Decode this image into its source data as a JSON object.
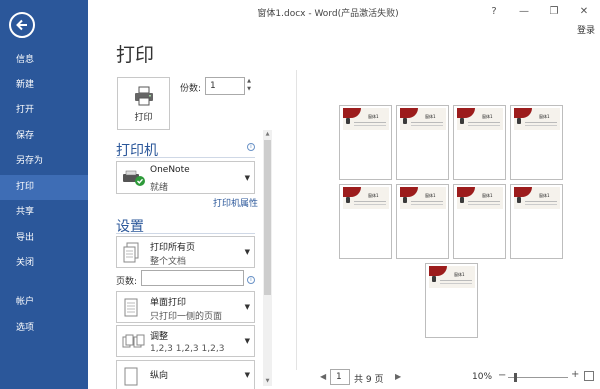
{
  "titlebar": {
    "title": "窗体1.docx - Word(产品激活失败)",
    "help": "?",
    "minimize": "—",
    "restore": "❐",
    "close": "✕",
    "login": "登录"
  },
  "nav": {
    "items": [
      {
        "label": "信息"
      },
      {
        "label": "新建"
      },
      {
        "label": "打开"
      },
      {
        "label": "保存"
      },
      {
        "label": "另存为"
      },
      {
        "label": "打印"
      },
      {
        "label": "共享"
      },
      {
        "label": "导出"
      },
      {
        "label": "关闭"
      },
      {
        "label": "帐户"
      },
      {
        "label": "选项"
      }
    ]
  },
  "print": {
    "title": "打印",
    "button_label": "打印",
    "copies_label": "份数:",
    "copies_value": "1",
    "printer_section": "打印机",
    "printer_name": "OneNote",
    "printer_status": "就绪",
    "printer_properties": "打印机属性",
    "settings_section": "设置",
    "pages_label": "页数:",
    "pages_value": "",
    "settings": [
      {
        "title": "打印所有页",
        "sub": "整个文档"
      },
      {
        "title": "单面打印",
        "sub": "只打印一侧的页面"
      },
      {
        "title": "调整",
        "sub": "1,2,3    1,2,3    1,2,3"
      },
      {
        "title": "纵向",
        "sub": ""
      }
    ],
    "info_glyph": "i"
  },
  "preview": {
    "page_number": "1",
    "total_pages": "共 9 页",
    "zoom": "10%",
    "thumb_watermark": "窗体1"
  },
  "colors": {
    "accent": "#2b579a",
    "accent_active": "#3e6db5",
    "page_red": "#9c1c1c"
  }
}
